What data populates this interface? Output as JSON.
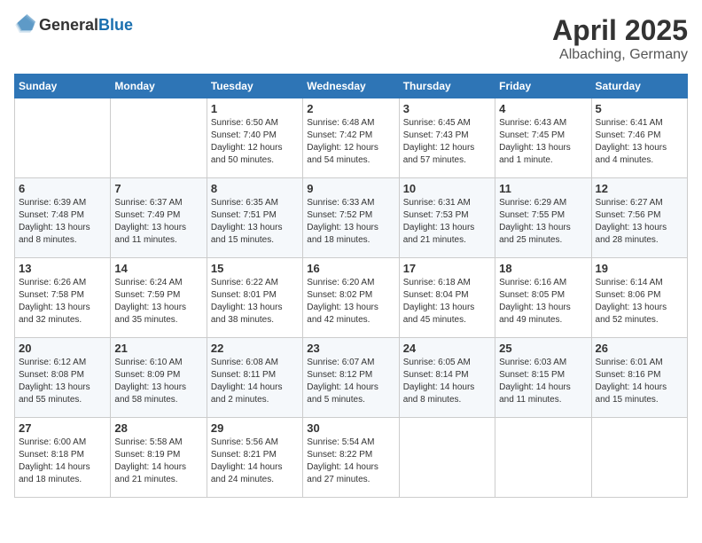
{
  "header": {
    "logo_general": "General",
    "logo_blue": "Blue",
    "month": "April 2025",
    "location": "Albaching, Germany"
  },
  "columns": [
    "Sunday",
    "Monday",
    "Tuesday",
    "Wednesday",
    "Thursday",
    "Friday",
    "Saturday"
  ],
  "weeks": [
    [
      {
        "day": "",
        "info": ""
      },
      {
        "day": "",
        "info": ""
      },
      {
        "day": "1",
        "info": "Sunrise: 6:50 AM\nSunset: 7:40 PM\nDaylight: 12 hours and 50 minutes."
      },
      {
        "day": "2",
        "info": "Sunrise: 6:48 AM\nSunset: 7:42 PM\nDaylight: 12 hours and 54 minutes."
      },
      {
        "day": "3",
        "info": "Sunrise: 6:45 AM\nSunset: 7:43 PM\nDaylight: 12 hours and 57 minutes."
      },
      {
        "day": "4",
        "info": "Sunrise: 6:43 AM\nSunset: 7:45 PM\nDaylight: 13 hours and 1 minute."
      },
      {
        "day": "5",
        "info": "Sunrise: 6:41 AM\nSunset: 7:46 PM\nDaylight: 13 hours and 4 minutes."
      }
    ],
    [
      {
        "day": "6",
        "info": "Sunrise: 6:39 AM\nSunset: 7:48 PM\nDaylight: 13 hours and 8 minutes."
      },
      {
        "day": "7",
        "info": "Sunrise: 6:37 AM\nSunset: 7:49 PM\nDaylight: 13 hours and 11 minutes."
      },
      {
        "day": "8",
        "info": "Sunrise: 6:35 AM\nSunset: 7:51 PM\nDaylight: 13 hours and 15 minutes."
      },
      {
        "day": "9",
        "info": "Sunrise: 6:33 AM\nSunset: 7:52 PM\nDaylight: 13 hours and 18 minutes."
      },
      {
        "day": "10",
        "info": "Sunrise: 6:31 AM\nSunset: 7:53 PM\nDaylight: 13 hours and 21 minutes."
      },
      {
        "day": "11",
        "info": "Sunrise: 6:29 AM\nSunset: 7:55 PM\nDaylight: 13 hours and 25 minutes."
      },
      {
        "day": "12",
        "info": "Sunrise: 6:27 AM\nSunset: 7:56 PM\nDaylight: 13 hours and 28 minutes."
      }
    ],
    [
      {
        "day": "13",
        "info": "Sunrise: 6:26 AM\nSunset: 7:58 PM\nDaylight: 13 hours and 32 minutes."
      },
      {
        "day": "14",
        "info": "Sunrise: 6:24 AM\nSunset: 7:59 PM\nDaylight: 13 hours and 35 minutes."
      },
      {
        "day": "15",
        "info": "Sunrise: 6:22 AM\nSunset: 8:01 PM\nDaylight: 13 hours and 38 minutes."
      },
      {
        "day": "16",
        "info": "Sunrise: 6:20 AM\nSunset: 8:02 PM\nDaylight: 13 hours and 42 minutes."
      },
      {
        "day": "17",
        "info": "Sunrise: 6:18 AM\nSunset: 8:04 PM\nDaylight: 13 hours and 45 minutes."
      },
      {
        "day": "18",
        "info": "Sunrise: 6:16 AM\nSunset: 8:05 PM\nDaylight: 13 hours and 49 minutes."
      },
      {
        "day": "19",
        "info": "Sunrise: 6:14 AM\nSunset: 8:06 PM\nDaylight: 13 hours and 52 minutes."
      }
    ],
    [
      {
        "day": "20",
        "info": "Sunrise: 6:12 AM\nSunset: 8:08 PM\nDaylight: 13 hours and 55 minutes."
      },
      {
        "day": "21",
        "info": "Sunrise: 6:10 AM\nSunset: 8:09 PM\nDaylight: 13 hours and 58 minutes."
      },
      {
        "day": "22",
        "info": "Sunrise: 6:08 AM\nSunset: 8:11 PM\nDaylight: 14 hours and 2 minutes."
      },
      {
        "day": "23",
        "info": "Sunrise: 6:07 AM\nSunset: 8:12 PM\nDaylight: 14 hours and 5 minutes."
      },
      {
        "day": "24",
        "info": "Sunrise: 6:05 AM\nSunset: 8:14 PM\nDaylight: 14 hours and 8 minutes."
      },
      {
        "day": "25",
        "info": "Sunrise: 6:03 AM\nSunset: 8:15 PM\nDaylight: 14 hours and 11 minutes."
      },
      {
        "day": "26",
        "info": "Sunrise: 6:01 AM\nSunset: 8:16 PM\nDaylight: 14 hours and 15 minutes."
      }
    ],
    [
      {
        "day": "27",
        "info": "Sunrise: 6:00 AM\nSunset: 8:18 PM\nDaylight: 14 hours and 18 minutes."
      },
      {
        "day": "28",
        "info": "Sunrise: 5:58 AM\nSunset: 8:19 PM\nDaylight: 14 hours and 21 minutes."
      },
      {
        "day": "29",
        "info": "Sunrise: 5:56 AM\nSunset: 8:21 PM\nDaylight: 14 hours and 24 minutes."
      },
      {
        "day": "30",
        "info": "Sunrise: 5:54 AM\nSunset: 8:22 PM\nDaylight: 14 hours and 27 minutes."
      },
      {
        "day": "",
        "info": ""
      },
      {
        "day": "",
        "info": ""
      },
      {
        "day": "",
        "info": ""
      }
    ]
  ]
}
